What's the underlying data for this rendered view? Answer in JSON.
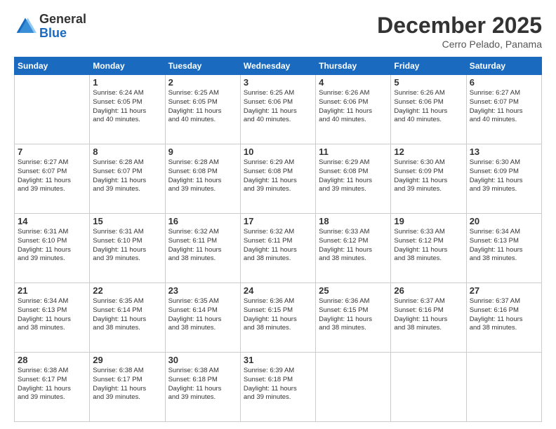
{
  "header": {
    "logo_general": "General",
    "logo_blue": "Blue",
    "month_title": "December 2025",
    "location": "Cerro Pelado, Panama"
  },
  "days_of_week": [
    "Sunday",
    "Monday",
    "Tuesday",
    "Wednesday",
    "Thursday",
    "Friday",
    "Saturday"
  ],
  "weeks": [
    [
      {
        "day": "",
        "info": ""
      },
      {
        "day": "1",
        "info": "Sunrise: 6:24 AM\nSunset: 6:05 PM\nDaylight: 11 hours\nand 40 minutes."
      },
      {
        "day": "2",
        "info": "Sunrise: 6:25 AM\nSunset: 6:05 PM\nDaylight: 11 hours\nand 40 minutes."
      },
      {
        "day": "3",
        "info": "Sunrise: 6:25 AM\nSunset: 6:06 PM\nDaylight: 11 hours\nand 40 minutes."
      },
      {
        "day": "4",
        "info": "Sunrise: 6:26 AM\nSunset: 6:06 PM\nDaylight: 11 hours\nand 40 minutes."
      },
      {
        "day": "5",
        "info": "Sunrise: 6:26 AM\nSunset: 6:06 PM\nDaylight: 11 hours\nand 40 minutes."
      },
      {
        "day": "6",
        "info": "Sunrise: 6:27 AM\nSunset: 6:07 PM\nDaylight: 11 hours\nand 40 minutes."
      }
    ],
    [
      {
        "day": "7",
        "info": "Sunrise: 6:27 AM\nSunset: 6:07 PM\nDaylight: 11 hours\nand 39 minutes."
      },
      {
        "day": "8",
        "info": "Sunrise: 6:28 AM\nSunset: 6:07 PM\nDaylight: 11 hours\nand 39 minutes."
      },
      {
        "day": "9",
        "info": "Sunrise: 6:28 AM\nSunset: 6:08 PM\nDaylight: 11 hours\nand 39 minutes."
      },
      {
        "day": "10",
        "info": "Sunrise: 6:29 AM\nSunset: 6:08 PM\nDaylight: 11 hours\nand 39 minutes."
      },
      {
        "day": "11",
        "info": "Sunrise: 6:29 AM\nSunset: 6:08 PM\nDaylight: 11 hours\nand 39 minutes."
      },
      {
        "day": "12",
        "info": "Sunrise: 6:30 AM\nSunset: 6:09 PM\nDaylight: 11 hours\nand 39 minutes."
      },
      {
        "day": "13",
        "info": "Sunrise: 6:30 AM\nSunset: 6:09 PM\nDaylight: 11 hours\nand 39 minutes."
      }
    ],
    [
      {
        "day": "14",
        "info": "Sunrise: 6:31 AM\nSunset: 6:10 PM\nDaylight: 11 hours\nand 39 minutes."
      },
      {
        "day": "15",
        "info": "Sunrise: 6:31 AM\nSunset: 6:10 PM\nDaylight: 11 hours\nand 39 minutes."
      },
      {
        "day": "16",
        "info": "Sunrise: 6:32 AM\nSunset: 6:11 PM\nDaylight: 11 hours\nand 38 minutes."
      },
      {
        "day": "17",
        "info": "Sunrise: 6:32 AM\nSunset: 6:11 PM\nDaylight: 11 hours\nand 38 minutes."
      },
      {
        "day": "18",
        "info": "Sunrise: 6:33 AM\nSunset: 6:12 PM\nDaylight: 11 hours\nand 38 minutes."
      },
      {
        "day": "19",
        "info": "Sunrise: 6:33 AM\nSunset: 6:12 PM\nDaylight: 11 hours\nand 38 minutes."
      },
      {
        "day": "20",
        "info": "Sunrise: 6:34 AM\nSunset: 6:13 PM\nDaylight: 11 hours\nand 38 minutes."
      }
    ],
    [
      {
        "day": "21",
        "info": "Sunrise: 6:34 AM\nSunset: 6:13 PM\nDaylight: 11 hours\nand 38 minutes."
      },
      {
        "day": "22",
        "info": "Sunrise: 6:35 AM\nSunset: 6:14 PM\nDaylight: 11 hours\nand 38 minutes."
      },
      {
        "day": "23",
        "info": "Sunrise: 6:35 AM\nSunset: 6:14 PM\nDaylight: 11 hours\nand 38 minutes."
      },
      {
        "day": "24",
        "info": "Sunrise: 6:36 AM\nSunset: 6:15 PM\nDaylight: 11 hours\nand 38 minutes."
      },
      {
        "day": "25",
        "info": "Sunrise: 6:36 AM\nSunset: 6:15 PM\nDaylight: 11 hours\nand 38 minutes."
      },
      {
        "day": "26",
        "info": "Sunrise: 6:37 AM\nSunset: 6:16 PM\nDaylight: 11 hours\nand 38 minutes."
      },
      {
        "day": "27",
        "info": "Sunrise: 6:37 AM\nSunset: 6:16 PM\nDaylight: 11 hours\nand 38 minutes."
      }
    ],
    [
      {
        "day": "28",
        "info": "Sunrise: 6:38 AM\nSunset: 6:17 PM\nDaylight: 11 hours\nand 39 minutes."
      },
      {
        "day": "29",
        "info": "Sunrise: 6:38 AM\nSunset: 6:17 PM\nDaylight: 11 hours\nand 39 minutes."
      },
      {
        "day": "30",
        "info": "Sunrise: 6:38 AM\nSunset: 6:18 PM\nDaylight: 11 hours\nand 39 minutes."
      },
      {
        "day": "31",
        "info": "Sunrise: 6:39 AM\nSunset: 6:18 PM\nDaylight: 11 hours\nand 39 minutes."
      },
      {
        "day": "",
        "info": ""
      },
      {
        "day": "",
        "info": ""
      },
      {
        "day": "",
        "info": ""
      }
    ]
  ]
}
